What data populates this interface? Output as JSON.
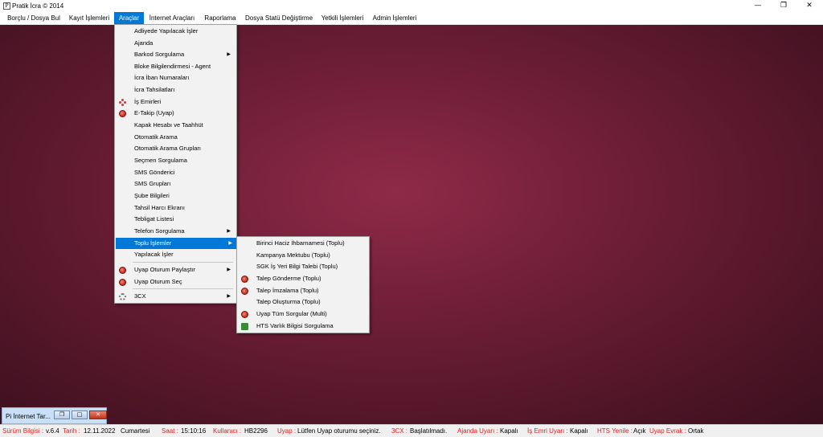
{
  "window": {
    "title": "Pratik İcra © 2014",
    "icon": "app-icon"
  },
  "window_controls": {
    "minimize": "—",
    "maximize": "❐",
    "close": "✕"
  },
  "menubar": [
    "Borçlu / Dosya Bul",
    "Kayıt İşlemleri",
    "Araçlar",
    "İnternet Araçları",
    "Raporlama",
    "Dosya Statü Değiştirme",
    "Yetkili İşlemleri",
    "Admin İşlemleri"
  ],
  "menubar_active": "Araçlar",
  "araclar_menu": {
    "items": [
      {
        "label": "Adliyede Yapılacak İşler"
      },
      {
        "label": "Ajanda"
      },
      {
        "label": "Barkod Sorgulama",
        "submenu": true
      },
      {
        "label": "Bloke Bilgilendirmesi - Agent"
      },
      {
        "label": "İcra İban Numaraları"
      },
      {
        "label": "İcra Tahsilatları"
      },
      {
        "label": "İş Emirleri",
        "icon": "work-order-icon"
      },
      {
        "label": "E-Takip (Uyap)",
        "icon": "uyap-icon"
      },
      {
        "label": "Kapak Hesabı ve Taahhüt"
      },
      {
        "label": "Otomatik Arama"
      },
      {
        "label": "Otomatik Arama Grupları"
      },
      {
        "label": "Seçmen Sorgulama"
      },
      {
        "label": "SMS Gönderici"
      },
      {
        "label": "SMS Grupları"
      },
      {
        "label": "Şube Bilgileri"
      },
      {
        "label": "Tahsil Harcı Ekranı"
      },
      {
        "label": "Tebligat Listesi"
      },
      {
        "label": "Telefon Sorgulama",
        "submenu": true
      },
      {
        "label": "Toplu İşlemler",
        "submenu": true,
        "active": true
      },
      {
        "label": "Yapılacak İşler"
      },
      {
        "label": "Uyap Oturum Paylaştır",
        "icon": "uyap-icon",
        "submenu": true
      },
      {
        "label": "Uyap Oturum Seç",
        "icon": "uyap-icon"
      },
      {
        "label": "3CX",
        "icon": "3cx-gear-icon",
        "submenu": true
      }
    ]
  },
  "toplu_menu": {
    "items": [
      {
        "label": "Birinci Haciz İhbarnamesi (Toplu)"
      },
      {
        "label": "Kampanya Mektubu (Toplu)"
      },
      {
        "label": "SGK İş Yeri Bilgi Talebi (Toplu)"
      },
      {
        "label": "Talep Gönderme (Toplu)",
        "icon": "uyap-icon"
      },
      {
        "label": "Talep İmzalama (Toplu)",
        "icon": "signature-icon"
      },
      {
        "label": "Talep Oluşturma (Toplu)"
      },
      {
        "label": "Uyap Tüm Sorgular (Multi)",
        "icon": "uyap-icon"
      },
      {
        "label": "HTS Varlık Bilgisi Sorgulama",
        "icon": "hts-icon"
      }
    ]
  },
  "mini_window": {
    "title": "Pi İnternet Tar..."
  },
  "statusbar": {
    "surum_label": "Sürüm Bilgisi :",
    "surum_value": "v.6.4",
    "tarih_label": "Tarih :",
    "tarih_value": "12.11.2022",
    "day_value": "Cumartesi",
    "saat_label": "Saat :",
    "saat_value": "15:10:16",
    "kullanici_label": "Kullanıcı :",
    "kullanici_value": "HB2296",
    "uyap_label": "Uyap :",
    "uyap_value": "Lütfen Uyap oturumu seçiniz.",
    "cx_label": "3CX :",
    "cx_value": "Başlatılmadı.",
    "ajanda_label": "Ajanda Uyarı :",
    "ajanda_value": "Kapalı",
    "isemri_label": "İş Emri Uyarı :",
    "isemri_value": "Kapalı",
    "hts_label": "HTS Yenile :",
    "hts_value": "Açık",
    "uyapevrak_label": "Uyap Evrak :",
    "uyapevrak_value": "Ortak"
  },
  "colors": {
    "desktop_bg": "#6d1e37",
    "highlight": "#0078d7",
    "status_label": "#e02020"
  }
}
